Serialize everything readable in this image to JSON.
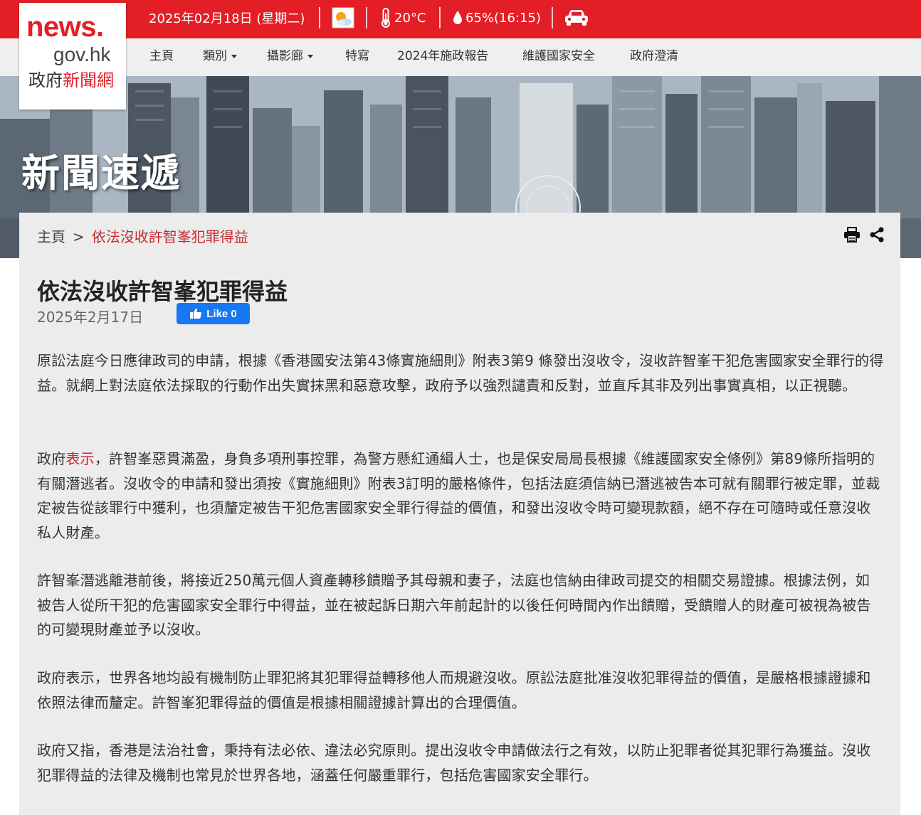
{
  "top_bar": {
    "date": "2025年02月18日 (星期二)",
    "weather_icon": "sun-cloud-icon",
    "temperature": "20°C",
    "humidity": "65%(16:15)",
    "traffic_icon": "car-icon",
    "color": "#e41e26"
  },
  "logo": {
    "line1": "news.",
    "line2": "gov.hk",
    "line3_black": "政府",
    "line3_red": "新聞網"
  },
  "nav": {
    "items": [
      "主頁",
      "類別",
      "攝影廊",
      "特寫",
      "2024年施政報告",
      "維護國家安全",
      "政府澄清"
    ]
  },
  "banner": {
    "title": "新聞速遞"
  },
  "breadcrumb": {
    "home": "主頁",
    "separator": ">",
    "current": "依法沒收許智峯犯罪得益"
  },
  "toolbar": {
    "print_icon": "print-icon",
    "share_icon": "share-icon"
  },
  "article": {
    "title": "依法沒收許智峯犯罪得益",
    "date": "2025年2月17日",
    "like_label": "Like 0",
    "p1": "原訟法庭今日應律政司的申請，根據《香港國安法第43條實施細則》附表3第9 條發出沒收令，沒收許智峯干犯危害國家安全罪行的得益。就網上對法庭依法採取的行動作出失實抹黑和惡意攻擊，政府予以強烈譴責和反對，並直斥其非及列出事實真相，以正視聽。",
    "p2_pre": "政府",
    "p2_link": "表示",
    "p2_post": "，許智峯惡貫滿盈，身負多項刑事控罪，為警方懸紅通緝人士，也是保安局局長根據《維護國家安全條例》第89條所指明的有關潛逃者。沒收令的申請和發出須按《實施細則》附表3訂明的嚴格條件，包括法庭須信納已潛逃被告本可就有關罪行被定罪，並裁定被告從該罪行中獲利，也須釐定被告干犯危害國家安全罪行得益的價值，和發出沒收令時可變現款額，絕不存在可隨時或任意沒收私人財產。",
    "p3": "許智峯潛逃離港前後，將接近250萬元個人資產轉移饋贈予其母親和妻子，法庭也信納由律政司提交的相關交易證據。根據法例，如被告人從所干犯的危害國家安全罪行中得益，並在被起訴日期六年前起計的以後任何時間內作出饋贈，受饋贈人的財產可被視為被告的可變現財產並予以沒收。",
    "p4": "政府表示，世界各地均設有機制防止罪犯將其犯罪得益轉移他人而規避沒收。原訟法庭批准沒收犯罪得益的價值，是嚴格根據證據和依照法律而釐定。許智峯犯罪得益的價值是根據相關證據計算出的合理價值。",
    "p5": "政府又指，香港是法治社會，秉持有法必依、違法必究原則。提出沒收令申請做法行之有效，以防止犯罪者從其犯罪行為獲益。沒收犯罪得益的法律及機制也常見於世界各地，涵蓋任何嚴重罪行，包括危害國家安全罪行。"
  }
}
